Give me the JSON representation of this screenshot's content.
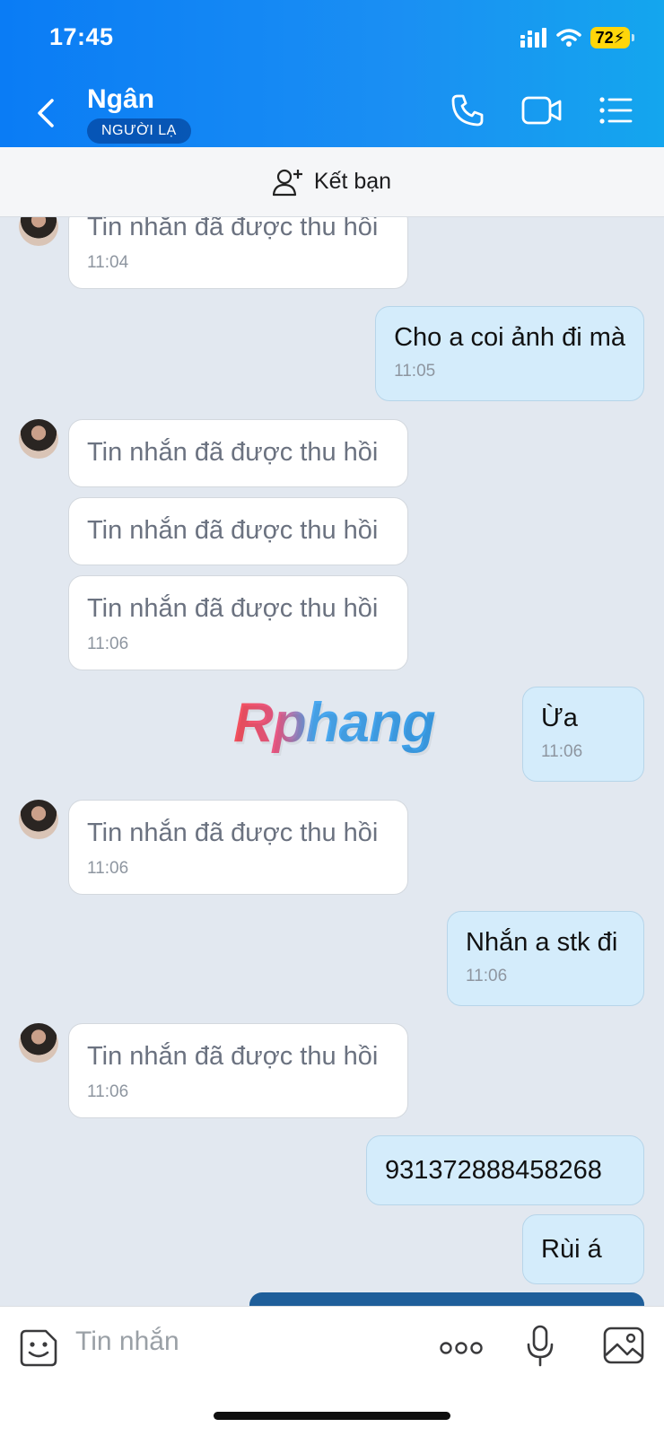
{
  "status_bar": {
    "time": "17:45",
    "battery": "72"
  },
  "header": {
    "title": "Ngân",
    "badge": "NGƯỜI LẠ"
  },
  "friend_bar": {
    "label": "Kết bạn"
  },
  "messages": [
    {
      "text": "Tin nhắn đã được thu hồi",
      "time": "11:04"
    },
    {
      "text": "Cho a coi ảnh đi mà",
      "time": "11:05"
    },
    {
      "text": "Tin nhắn đã được thu hồi"
    },
    {
      "text": "Tin nhắn đã được thu hồi"
    },
    {
      "text": "Tin nhắn đã được thu hồi",
      "time": "11:06"
    },
    {
      "text": "Ừa",
      "time": "11:06"
    },
    {
      "text": "Tin nhắn đã được thu hồi",
      "time": "11:06"
    },
    {
      "text": "Nhắn a stk đi",
      "time": "11:06"
    },
    {
      "text": "Tin nhắn đã được thu hồi",
      "time": "11:06"
    },
    {
      "text": "931372888458268"
    },
    {
      "text": "Rùi á"
    }
  ],
  "watermark": "Rphang",
  "input": {
    "placeholder": "Tin nhắn"
  },
  "icons": {
    "back": "chevron-left-icon",
    "call": "phone-icon",
    "video": "video-camera-icon",
    "menu": "list-menu-icon",
    "add_friend": "add-person-icon",
    "emoji": "sticker-icon",
    "more": "more-dots-icon",
    "mic": "microphone-icon",
    "gallery": "image-icon"
  },
  "colors": {
    "header_gradient_start": "#0a7cf5",
    "header_gradient_end": "#14a6ee",
    "incoming_bubble": "#ffffff",
    "outgoing_bubble": "#d4ecfb",
    "chat_background": "#e2e8f0"
  }
}
